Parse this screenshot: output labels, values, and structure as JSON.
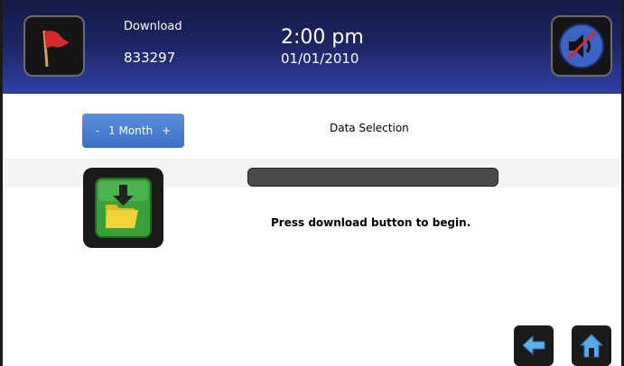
{
  "header": {
    "mode_title": "Download",
    "mode_id": "833297",
    "time": "2:00 pm",
    "date": "01/01/2010",
    "flag_icon": "red-flag-icon",
    "mute_icon": "speaker-muted-icon"
  },
  "selector": {
    "minus": "-",
    "value": "1 Month",
    "plus": "+"
  },
  "panel": {
    "title": "Data Selection",
    "status_text": "Press download button to begin.",
    "progress_fraction": 0
  },
  "footer": {
    "back_icon": "back-arrow-icon",
    "home_icon": "home-icon"
  },
  "colors": {
    "header_dark": "#141a45",
    "header_light": "#2d3fa2",
    "accent_blue": "#3d6fc4",
    "flag_red": "#d42a2a",
    "folder_yellow": "#f2d43a",
    "download_green": "#39a03a"
  }
}
